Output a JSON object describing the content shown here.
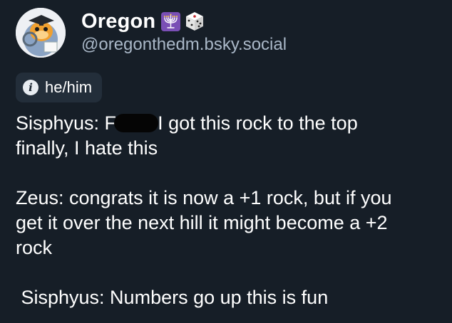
{
  "profile": {
    "display_name": "Oregon",
    "handle": "@oregonthedm.bsky.social",
    "badges": [
      "menorah-icon",
      "dice-icon"
    ],
    "pronoun_badge": {
      "icon": "info-icon",
      "icon_glyph": "i",
      "label": "he/him"
    }
  },
  "post": {
    "line1_before": "Sisphyus: F",
    "line1_after": "I got this rock to the top",
    "line2": "finally, I hate this",
    "line3": "Zeus: congrats it is now a +1 rock, but if you",
    "line4": "get it over the next hill it might become a +2",
    "line5": "rock",
    "line6": " Sisphyus: Numbers go up this is fun"
  },
  "colors": {
    "background": "#161e27",
    "text": "#ffffff",
    "handle": "#aab8c8",
    "pill": "#232e3a",
    "menorah_badge": "#7a4fb5"
  }
}
